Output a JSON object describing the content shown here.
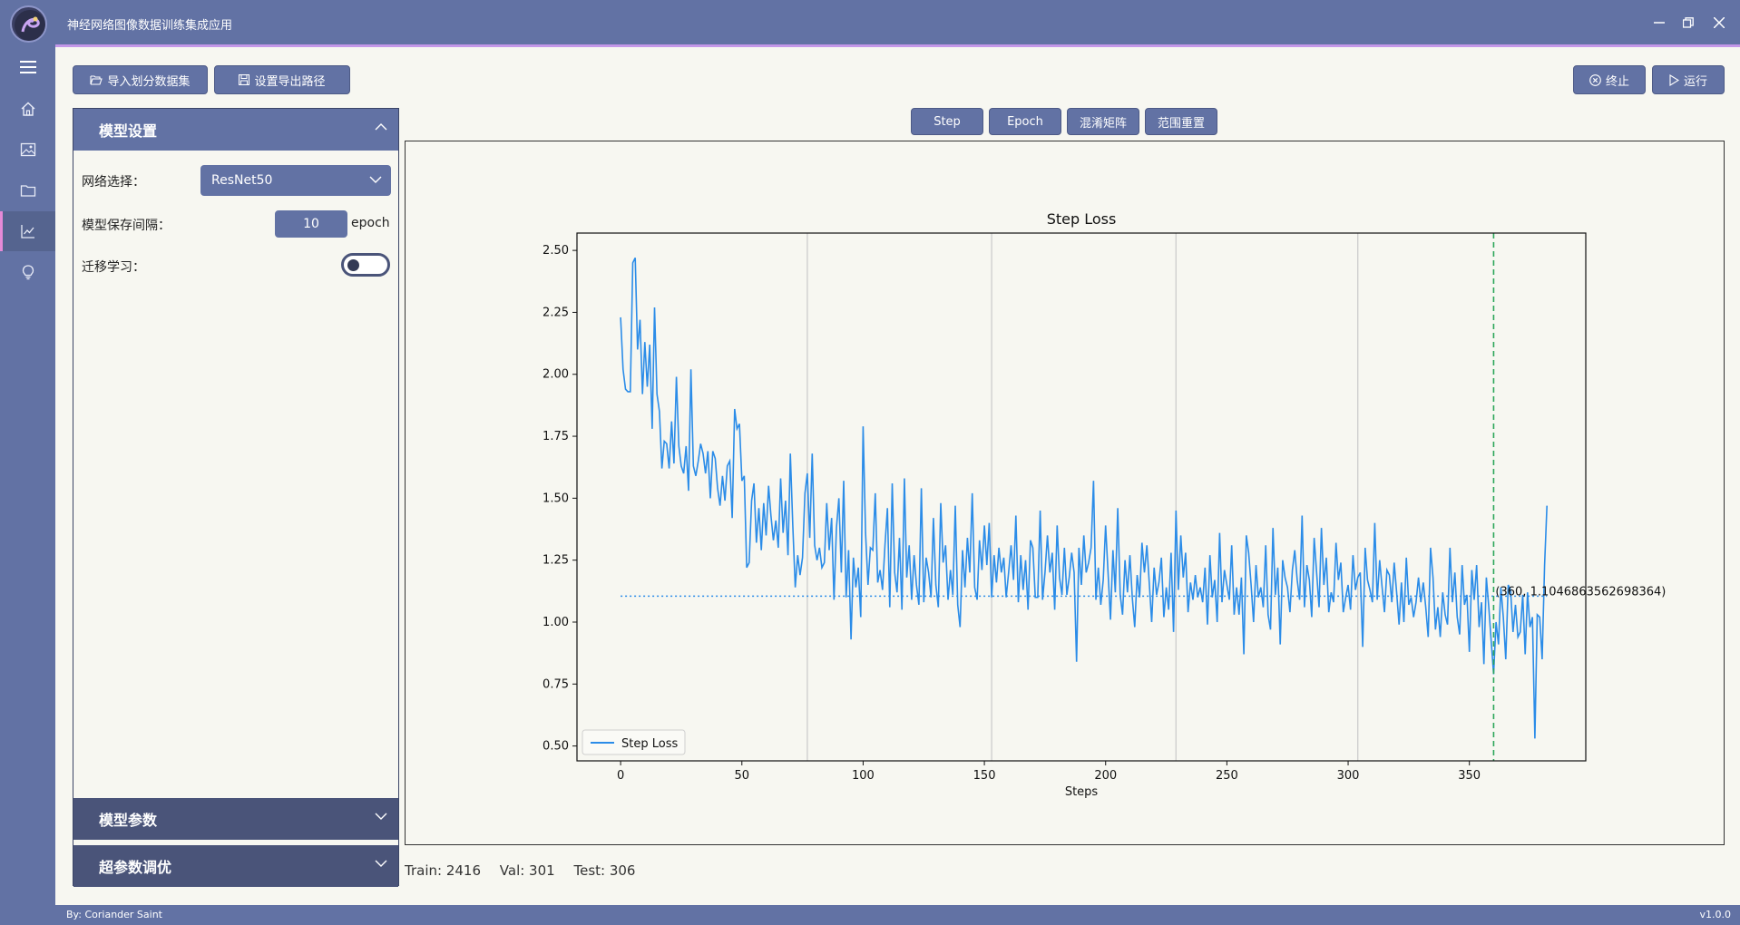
{
  "app": {
    "title": "神经网络图像数据训练集成应用"
  },
  "toolbar": {
    "import_label": "导入划分数据集",
    "export_label": "设置导出路径",
    "stop_label": "终止",
    "run_label": "运行"
  },
  "sidebar": {
    "items": [
      {
        "icon": "home-icon"
      },
      {
        "icon": "image-icon"
      },
      {
        "icon": "folder-icon"
      },
      {
        "icon": "chart-icon",
        "active": true
      },
      {
        "icon": "lightbulb-icon"
      }
    ]
  },
  "panel": {
    "section1": "模型设置",
    "network_label": "网络选择：",
    "network_value": "ResNet50",
    "save_interval_label": "模型保存间隔：",
    "save_interval_value": "10",
    "save_interval_unit": "epoch",
    "transfer_label": "迁移学习：",
    "transfer_on": false,
    "section2": "模型参数",
    "section3": "超参数调优"
  },
  "tabs": [
    "Step",
    "Epoch",
    "混淆矩阵",
    "范围重置"
  ],
  "chart_data": {
    "type": "line",
    "title": "Step Loss",
    "xlabel": "Steps",
    "ylabel": "",
    "xlim": [
      -18,
      398
    ],
    "ylim": [
      0.44,
      2.57
    ],
    "xticks": [
      0,
      50,
      100,
      150,
      200,
      250,
      300,
      350
    ],
    "yticks": [
      0.5,
      0.75,
      1.0,
      1.25,
      1.5,
      1.75,
      2.0,
      2.25,
      2.5
    ],
    "epoch_lines_x": [
      77,
      153,
      229,
      304
    ],
    "cursor_x": 360,
    "mean_y": 1.1046863562698364,
    "annotation": "(360, 1.1046863562698364)",
    "legend": "Step Loss",
    "legend_position": "lower-left",
    "series": [
      {
        "name": "Step Loss",
        "color": "#2b8ce8",
        "values": [
          2.23,
          2.02,
          1.94,
          1.93,
          1.93,
          2.45,
          2.47,
          2.1,
          2.22,
          1.92,
          2.13,
          1.95,
          2.12,
          1.78,
          2.27,
          1.92,
          1.85,
          1.62,
          1.73,
          1.72,
          1.62,
          1.81,
          1.64,
          1.99,
          1.71,
          1.63,
          1.6,
          1.71,
          1.53,
          2.02,
          1.63,
          1.59,
          1.65,
          1.72,
          1.68,
          1.6,
          1.69,
          1.5,
          1.69,
          1.66,
          1.54,
          1.47,
          1.59,
          1.49,
          1.63,
          1.65,
          1.42,
          1.86,
          1.78,
          1.8,
          1.57,
          1.59,
          1.22,
          1.24,
          1.49,
          1.56,
          1.32,
          1.46,
          1.29,
          1.48,
          1.35,
          1.55,
          1.43,
          1.33,
          1.41,
          1.3,
          1.58,
          1.36,
          1.49,
          1.27,
          1.68,
          1.39,
          1.14,
          1.27,
          1.19,
          1.26,
          1.52,
          1.6,
          1.34,
          1.68,
          1.31,
          1.25,
          1.3,
          1.22,
          1.24,
          1.48,
          1.29,
          1.42,
          1.09,
          1.38,
          1.5,
          1.2,
          1.57,
          1.1,
          1.29,
          0.93,
          1.26,
          1.14,
          1.22,
          1.02,
          1.79,
          1.36,
          1.15,
          1.3,
          1.29,
          1.52,
          1.16,
          1.21,
          1.13,
          1.31,
          1.46,
          1.06,
          1.56,
          1.2,
          1.12,
          1.34,
          1.05,
          1.58,
          1.18,
          1.31,
          1.09,
          1.27,
          1.15,
          1.07,
          1.54,
          1.08,
          1.26,
          1.2,
          1.1,
          1.42,
          1.15,
          1.06,
          1.48,
          1.24,
          1.31,
          1.09,
          1.21,
          1.11,
          1.47,
          1.07,
          0.98,
          1.29,
          1.14,
          1.34,
          1.2,
          1.52,
          1.14,
          1.09,
          1.33,
          1.21,
          1.39,
          1.23,
          1.4,
          1.1,
          1.27,
          1.16,
          1.3,
          1.2,
          1.26,
          1.1,
          1.2,
          1.31,
          1.17,
          1.43,
          1.08,
          1.27,
          1.13,
          1.25,
          1.05,
          1.33,
          1.3,
          1.1,
          1.1,
          1.45,
          1.09,
          1.2,
          1.35,
          1.2,
          1.28,
          1.05,
          1.39,
          1.18,
          1.11,
          1.3,
          1.11,
          1.18,
          1.28,
          1.2,
          0.84,
          1.3,
          1.15,
          1.35,
          1.2,
          1.24,
          1.3,
          1.57,
          1.09,
          1.22,
          1.07,
          1.17,
          1.39,
          1.2,
          1.01,
          1.29,
          1.12,
          1.46,
          1.11,
          1.03,
          1.25,
          1.12,
          1.27,
          1.1,
          0.98,
          1.19,
          1.1,
          1.32,
          1.2,
          1.31,
          1.16,
          1.0,
          1.22,
          1.11,
          1.16,
          1.26,
          1.02,
          1.14,
          1.05,
          1.28,
          0.96,
          1.45,
          1.13,
          1.35,
          1.18,
          1.28,
          1.04,
          1.16,
          1.09,
          1.19,
          1.1,
          1.14,
          1.08,
          1.22,
          0.99,
          1.27,
          1.1,
          1.17,
          1.0,
          1.36,
          1.08,
          1.21,
          1.15,
          1.09,
          1.31,
          1.03,
          1.14,
          1.03,
          1.18,
          0.87,
          1.35,
          1.28,
          1.15,
          1.0,
          1.23,
          1.1,
          1.14,
          1.06,
          1.31,
          1.03,
          0.97,
          1.38,
          1.11,
          1.22,
          0.91,
          1.25,
          1.18,
          1.14,
          1.04,
          1.21,
          1.29,
          1.17,
          1.09,
          1.43,
          1.06,
          1.23,
          1.17,
          1.02,
          1.34,
          1.2,
          1.06,
          1.38,
          1.15,
          1.26,
          1.04,
          1.12,
          1.08,
          1.32,
          1.17,
          1.24,
          1.04,
          1.1,
          1.15,
          1.05,
          1.27,
          1.13,
          1.18,
          1.2,
          0.9,
          1.3,
          1.17,
          1.13,
          1.08,
          1.4,
          1.09,
          1.25,
          1.14,
          1.04,
          1.21,
          1.19,
          1.08,
          1.24,
          1.12,
          0.99,
          1.16,
          1.0,
          1.26,
          1.07,
          1.1,
          1.02,
          1.08,
          1.18,
          1.08,
          1.16,
          1.06,
          0.94,
          1.3,
          1.18,
          0.97,
          1.06,
          0.94,
          1.12,
          1.03,
          0.99,
          1.3,
          1.08,
          1.2,
          1.02,
          0.95,
          1.23,
          1.07,
          1.11,
          0.88,
          1.21,
          1.09,
          1.23,
          0.98,
          1.08,
          0.83,
          1.18,
          1.06,
          0.92,
          0.79,
          1.0,
          0.91,
          1.14,
          1.02,
          0.85,
          1.15,
          1.13,
          0.96,
          1.07,
          0.94,
          0.96,
          1.11,
          0.87,
          1.12,
          0.98,
          1.02,
          0.53,
          1.03,
          1.02,
          0.85,
          1.23,
          1.47
        ]
      }
    ]
  },
  "counts": {
    "train": "Train: 2416",
    "val": "Val: 301",
    "test": "Test: 306"
  },
  "status": {
    "author": "By: Coriander Saint",
    "version": "v1.0.0"
  }
}
